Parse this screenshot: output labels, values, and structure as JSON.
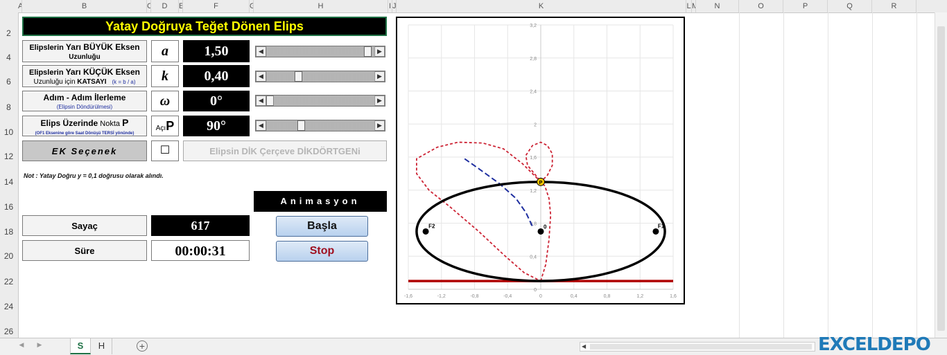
{
  "columns": [
    "A",
    "B",
    "C",
    "D",
    "E",
    "F",
    "G",
    "H",
    "I",
    "J",
    "K",
    "L",
    "M",
    "N",
    "O",
    "P",
    "Q",
    "R"
  ],
  "rows": [
    "2",
    "4",
    "6",
    "8",
    "10",
    "12",
    "14",
    "16",
    "18",
    "20",
    "22",
    "24",
    "26"
  ],
  "title": "Yatay Doğruya Teğet Dönen Elips",
  "params": [
    {
      "line1_pre": "Elipslerin ",
      "line1_bold": "Yarı BÜYÜK Eksen",
      "line2": "Uzunluğu",
      "line2_extra": "",
      "symbol": "a",
      "value": "1,50",
      "slider_pos": 0.97
    },
    {
      "line1_pre": "Elipslerin ",
      "line1_bold": "Yarı KÜÇÜK Eksen",
      "line2": "Uzunluğu için ",
      "line2_extra": "KATSAYI",
      "line2_note": "(k = b / a)",
      "symbol": "k",
      "value": "0,40",
      "slider_pos": 0.28
    },
    {
      "line1_pre": "",
      "line1_bold": "Adım - Adım İlerleme",
      "line2": "(Elipsin Döndürülmesi)",
      "line2_extra": "",
      "symbol": "ω",
      "value": "0°",
      "slider_pos": 0.0
    },
    {
      "line1_pre": "",
      "line1_bold": "Elips Üzerinde",
      "line1_post": " Nokta ",
      "line1_p": "P",
      "line2": "(OF1 Eksenine göre Saat Dönüşü TERSİ yönünde)",
      "line2_extra": "",
      "symbol_pre": "Açı",
      "symbol": "P",
      "value": "90°",
      "slider_pos": 0.31
    }
  ],
  "extra_option_label": "EK Seçenek",
  "extra_checkbox": "☐",
  "rect_button_label": "Elipsin DİK Çerçeve DİKDÖRTGENi",
  "note": "Not : Yatay Doğru  y = 0,1  doğrusu olarak alındı.",
  "animation_label": "Animasyon",
  "counter_label": "Sayaç",
  "counter_value": "617",
  "time_label": "Süre",
  "time_value": "00:00:31",
  "start_button": "Başla",
  "stop_button": "Stop",
  "sheet_tabs": [
    {
      "name": "S",
      "active": true
    },
    {
      "name": "H",
      "active": false
    }
  ],
  "add_sheet": "+",
  "brand": "EXCELDEPO",
  "colors": {
    "title_bg": "#000000",
    "title_text": "#ffff00",
    "ellipse": "#000000",
    "tangent_line": "#b00000",
    "curve": "#cc2233",
    "locus": "#1f2fa0",
    "point_p": "#f6c400",
    "stop_text": "#a01020"
  },
  "chart_data": {
    "type": "scatter",
    "xlim": [
      -1.6,
      1.6
    ],
    "ylim": [
      0,
      3.2
    ],
    "x_ticks": [
      "-1,6",
      "-1,2",
      "-0,8",
      "-0,4",
      "0",
      "0,4",
      "0,8",
      "1,2",
      "1,6"
    ],
    "y_ticks": [
      "0",
      "0,4",
      "0,8",
      "1,2",
      "1,6",
      "2",
      "2,4",
      "2,8",
      "3,2"
    ],
    "grid": true,
    "tangent_line_y": 0.1,
    "ellipse": {
      "center": [
        0,
        0.7
      ],
      "a": 1.5,
      "b": 0.6
    },
    "foci": [
      {
        "label": "F2",
        "x": -1.39,
        "y": 0.7
      },
      {
        "label": "F1",
        "x": 1.39,
        "y": 0.7
      }
    ],
    "center_point": {
      "label": "0",
      "x": 0,
      "y": 0.7
    },
    "point_p": {
      "label": "P",
      "x": 0,
      "y": 1.3
    },
    "red_curve": [
      [
        0,
        0.1
      ],
      [
        0.06,
        0.3
      ],
      [
        0.1,
        0.6
      ],
      [
        0.12,
        0.9
      ],
      [
        0.1,
        1.1
      ],
      [
        0.05,
        1.25
      ],
      [
        0,
        1.3
      ],
      [
        0.08,
        1.38
      ],
      [
        0.14,
        1.5
      ],
      [
        0.14,
        1.64
      ],
      [
        0.08,
        1.74
      ],
      [
        0,
        1.78
      ],
      [
        -0.1,
        1.74
      ],
      [
        -0.18,
        1.62
      ],
      [
        -0.16,
        1.5
      ],
      [
        -0.06,
        1.38
      ],
      [
        0,
        1.3
      ],
      [
        -0.22,
        1.52
      ],
      [
        -0.45,
        1.7
      ],
      [
        -0.7,
        1.77
      ],
      [
        -1.0,
        1.78
      ],
      [
        -1.25,
        1.72
      ],
      [
        -1.5,
        1.58
      ],
      [
        -1.5,
        1.4
      ],
      [
        -1.35,
        1.2
      ],
      [
        -1.1,
        1.0
      ],
      [
        -0.75,
        0.7
      ],
      [
        -0.45,
        0.42
      ],
      [
        -0.2,
        0.2
      ],
      [
        0,
        0.1
      ]
    ],
    "locus_curve": [
      [
        -0.92,
        1.58
      ],
      [
        -0.75,
        1.46
      ],
      [
        -0.5,
        1.28
      ],
      [
        -0.3,
        1.1
      ],
      [
        -0.18,
        0.93
      ],
      [
        -0.1,
        0.76
      ]
    ]
  }
}
